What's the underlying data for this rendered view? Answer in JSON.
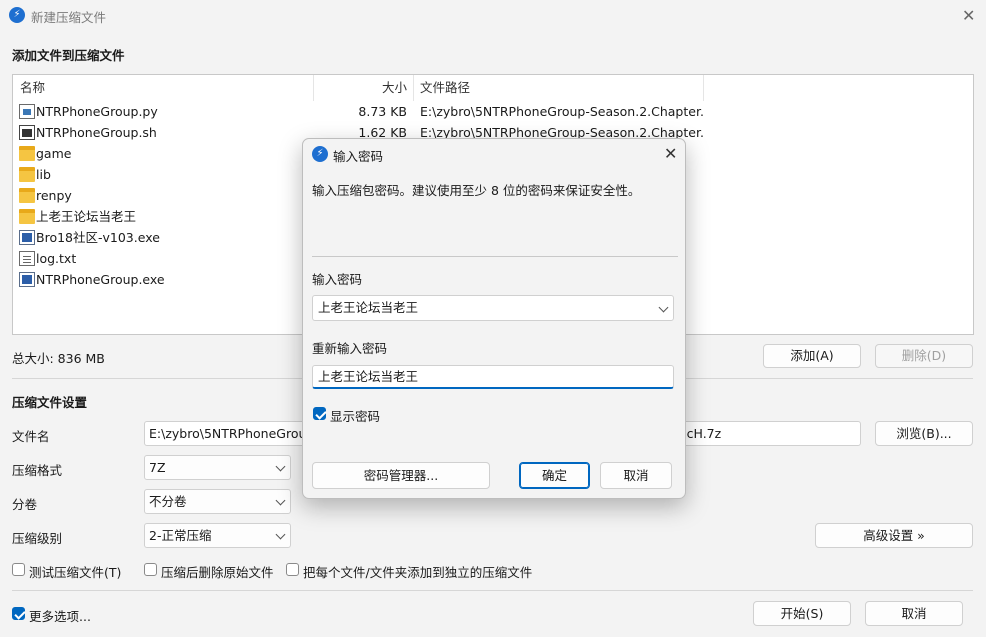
{
  "window": {
    "title": "新建压缩文件",
    "close_glyph": "✕"
  },
  "files_section": {
    "title": "添加文件到压缩文件",
    "columns": {
      "name": "名称",
      "size": "大小",
      "path": "文件路径"
    },
    "rows": [
      {
        "name": "NTRPhoneGroup.py",
        "size": "8.73 KB",
        "path": "E:\\zybro\\5NTRPhoneGroup-Season.2.Chapter....",
        "icon": "python-file-icon"
      },
      {
        "name": "NTRPhoneGroup.sh",
        "size": "1.62 KB",
        "path": "E:\\zybro\\5NTRPhoneGroup-Season.2.Chapter....",
        "icon": "shell-file-icon"
      },
      {
        "name": "game",
        "size": "",
        "path": "",
        "icon": "folder-icon"
      },
      {
        "name": "lib",
        "size": "",
        "path": "",
        "icon": "folder-icon"
      },
      {
        "name": "renpy",
        "size": "",
        "path": "",
        "icon": "folder-icon"
      },
      {
        "name": "上老王论坛当老王",
        "size": "",
        "path": "",
        "icon": "folder-icon"
      },
      {
        "name": "Bro18社区-v103.exe",
        "size": "",
        "path": "",
        "icon": "exe-file-icon"
      },
      {
        "name": "log.txt",
        "size": "",
        "path": "",
        "icon": "text-file-icon"
      },
      {
        "name": "NTRPhoneGroup.exe",
        "size": "",
        "path": "",
        "icon": "exe-file-icon"
      }
    ],
    "total_size": "总大小: 836 MB",
    "add_button": "添加(A)",
    "delete_button": "删除(D)"
  },
  "settings": {
    "title": "压缩文件设置",
    "filename_label": "文件名",
    "filename_value_left": "E:\\zybro\\5NTRPhoneGroup",
    "filename_value_right": "ocH.7z",
    "browse_button": "浏览(B)...",
    "format_label": "压缩格式",
    "format_value": "7Z",
    "split_label": "分卷",
    "split_value": "不分卷",
    "level_label": "压缩级别",
    "level_value": "2-正常压缩",
    "advanced_button": "高级设置 »",
    "test_checkbox": "测试压缩文件(T)",
    "delete_source_checkbox": "压缩后删除原始文件",
    "separate_checkbox": "把每个文件/文件夹添加到独立的压缩文件"
  },
  "footer": {
    "more_options": "更多选项...",
    "start_button": "开始(S)",
    "cancel_button": "取消"
  },
  "dialog": {
    "title": "输入密码",
    "description": "输入压缩包密码。建议使用至少 8 位的密码来保证安全性。",
    "password_label": "输入密码",
    "password_value": "上老王论坛当老王",
    "confirm_label": "重新输入密码",
    "confirm_value": "上老王论坛当老王",
    "show_password": "显示密码",
    "manager_button": "密码管理器...",
    "ok_button": "确定",
    "cancel_button": "取消"
  },
  "colors": {
    "accent": "#0067c0",
    "app_icon": "#1e6fd0"
  }
}
